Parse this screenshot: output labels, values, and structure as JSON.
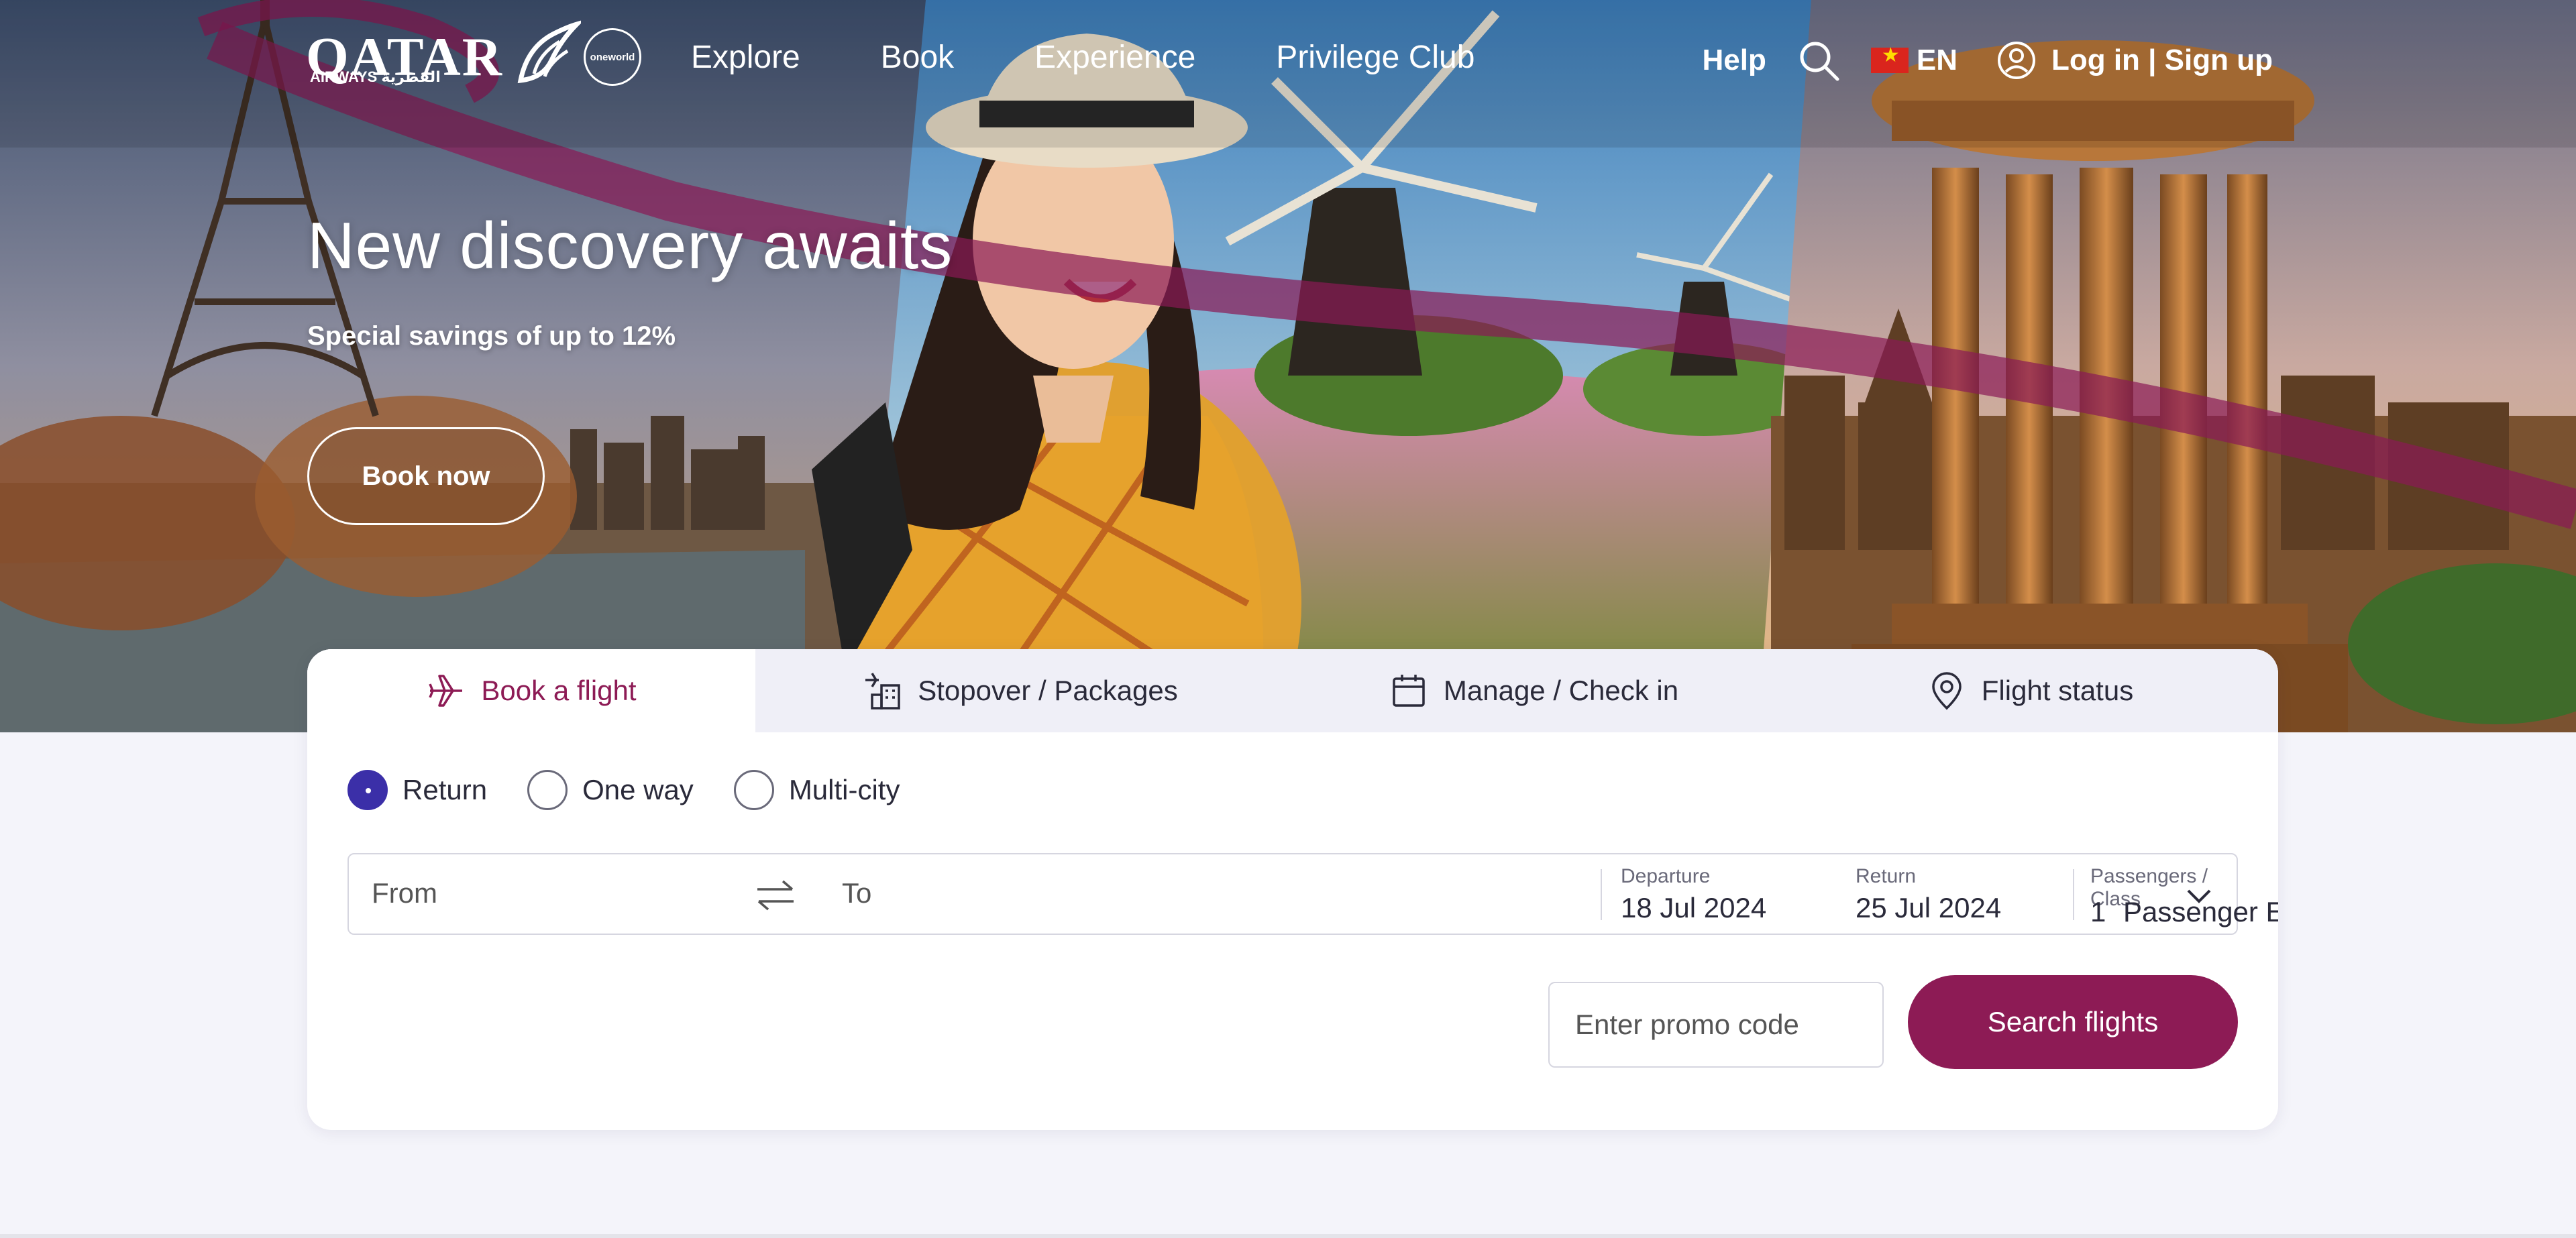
{
  "brand": {
    "logo_word": "QATAR",
    "logo_sub": "AIRWAYS القطرية",
    "alliance": "oneworld",
    "colors": {
      "primary": "#8d1b55",
      "radio_active": "#3b2fa8",
      "background": "#f4f4fa"
    }
  },
  "nav": {
    "items": [
      "Explore",
      "Book",
      "Experience",
      "Privilege Club"
    ],
    "help": "Help",
    "search_icon": "search-icon",
    "language": "EN",
    "account": "Log in | Sign up"
  },
  "hero": {
    "title": "New discovery awaits",
    "subtitle": "Special savings of up to 12%",
    "cta": "Book now"
  },
  "booking": {
    "tabs": [
      {
        "label": "Book a flight",
        "icon": "plane-icon",
        "active": true
      },
      {
        "label": "Stopover / Packages",
        "icon": "hotel-plane-icon",
        "active": false
      },
      {
        "label": "Manage / Check in",
        "icon": "calendar-icon",
        "active": false
      },
      {
        "label": "Flight status",
        "icon": "location-pin-icon",
        "active": false
      }
    ],
    "trip_types": [
      {
        "label": "Return",
        "checked": true
      },
      {
        "label": "One way",
        "checked": false
      },
      {
        "label": "Multi-city",
        "checked": false
      }
    ],
    "from_placeholder": "From",
    "to_placeholder": "To",
    "departure_label": "Departure",
    "departure_value": "18 Jul 2024",
    "return_label": "Return",
    "return_value": "25 Jul 2024",
    "pax_label": "Passengers / Class",
    "pax_count": "1",
    "pax_value": "Passenger Economy",
    "promo_placeholder": "Enter promo code",
    "search_button": "Search flights"
  }
}
